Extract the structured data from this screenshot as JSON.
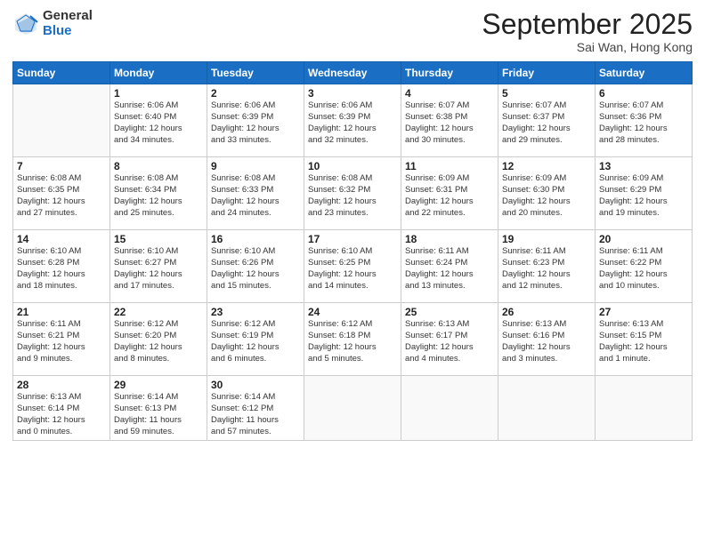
{
  "logo": {
    "general": "General",
    "blue": "Blue"
  },
  "title": "September 2025",
  "location": "Sai Wan, Hong Kong",
  "days_header": [
    "Sunday",
    "Monday",
    "Tuesday",
    "Wednesday",
    "Thursday",
    "Friday",
    "Saturday"
  ],
  "weeks": [
    [
      {
        "num": "",
        "info": ""
      },
      {
        "num": "1",
        "info": "Sunrise: 6:06 AM\nSunset: 6:40 PM\nDaylight: 12 hours\nand 34 minutes."
      },
      {
        "num": "2",
        "info": "Sunrise: 6:06 AM\nSunset: 6:39 PM\nDaylight: 12 hours\nand 33 minutes."
      },
      {
        "num": "3",
        "info": "Sunrise: 6:06 AM\nSunset: 6:39 PM\nDaylight: 12 hours\nand 32 minutes."
      },
      {
        "num": "4",
        "info": "Sunrise: 6:07 AM\nSunset: 6:38 PM\nDaylight: 12 hours\nand 30 minutes."
      },
      {
        "num": "5",
        "info": "Sunrise: 6:07 AM\nSunset: 6:37 PM\nDaylight: 12 hours\nand 29 minutes."
      },
      {
        "num": "6",
        "info": "Sunrise: 6:07 AM\nSunset: 6:36 PM\nDaylight: 12 hours\nand 28 minutes."
      }
    ],
    [
      {
        "num": "7",
        "info": "Sunrise: 6:08 AM\nSunset: 6:35 PM\nDaylight: 12 hours\nand 27 minutes."
      },
      {
        "num": "8",
        "info": "Sunrise: 6:08 AM\nSunset: 6:34 PM\nDaylight: 12 hours\nand 25 minutes."
      },
      {
        "num": "9",
        "info": "Sunrise: 6:08 AM\nSunset: 6:33 PM\nDaylight: 12 hours\nand 24 minutes."
      },
      {
        "num": "10",
        "info": "Sunrise: 6:08 AM\nSunset: 6:32 PM\nDaylight: 12 hours\nand 23 minutes."
      },
      {
        "num": "11",
        "info": "Sunrise: 6:09 AM\nSunset: 6:31 PM\nDaylight: 12 hours\nand 22 minutes."
      },
      {
        "num": "12",
        "info": "Sunrise: 6:09 AM\nSunset: 6:30 PM\nDaylight: 12 hours\nand 20 minutes."
      },
      {
        "num": "13",
        "info": "Sunrise: 6:09 AM\nSunset: 6:29 PM\nDaylight: 12 hours\nand 19 minutes."
      }
    ],
    [
      {
        "num": "14",
        "info": "Sunrise: 6:10 AM\nSunset: 6:28 PM\nDaylight: 12 hours\nand 18 minutes."
      },
      {
        "num": "15",
        "info": "Sunrise: 6:10 AM\nSunset: 6:27 PM\nDaylight: 12 hours\nand 17 minutes."
      },
      {
        "num": "16",
        "info": "Sunrise: 6:10 AM\nSunset: 6:26 PM\nDaylight: 12 hours\nand 15 minutes."
      },
      {
        "num": "17",
        "info": "Sunrise: 6:10 AM\nSunset: 6:25 PM\nDaylight: 12 hours\nand 14 minutes."
      },
      {
        "num": "18",
        "info": "Sunrise: 6:11 AM\nSunset: 6:24 PM\nDaylight: 12 hours\nand 13 minutes."
      },
      {
        "num": "19",
        "info": "Sunrise: 6:11 AM\nSunset: 6:23 PM\nDaylight: 12 hours\nand 12 minutes."
      },
      {
        "num": "20",
        "info": "Sunrise: 6:11 AM\nSunset: 6:22 PM\nDaylight: 12 hours\nand 10 minutes."
      }
    ],
    [
      {
        "num": "21",
        "info": "Sunrise: 6:11 AM\nSunset: 6:21 PM\nDaylight: 12 hours\nand 9 minutes."
      },
      {
        "num": "22",
        "info": "Sunrise: 6:12 AM\nSunset: 6:20 PM\nDaylight: 12 hours\nand 8 minutes."
      },
      {
        "num": "23",
        "info": "Sunrise: 6:12 AM\nSunset: 6:19 PM\nDaylight: 12 hours\nand 6 minutes."
      },
      {
        "num": "24",
        "info": "Sunrise: 6:12 AM\nSunset: 6:18 PM\nDaylight: 12 hours\nand 5 minutes."
      },
      {
        "num": "25",
        "info": "Sunrise: 6:13 AM\nSunset: 6:17 PM\nDaylight: 12 hours\nand 4 minutes."
      },
      {
        "num": "26",
        "info": "Sunrise: 6:13 AM\nSunset: 6:16 PM\nDaylight: 12 hours\nand 3 minutes."
      },
      {
        "num": "27",
        "info": "Sunrise: 6:13 AM\nSunset: 6:15 PM\nDaylight: 12 hours\nand 1 minute."
      }
    ],
    [
      {
        "num": "28",
        "info": "Sunrise: 6:13 AM\nSunset: 6:14 PM\nDaylight: 12 hours\nand 0 minutes."
      },
      {
        "num": "29",
        "info": "Sunrise: 6:14 AM\nSunset: 6:13 PM\nDaylight: 11 hours\nand 59 minutes."
      },
      {
        "num": "30",
        "info": "Sunrise: 6:14 AM\nSunset: 6:12 PM\nDaylight: 11 hours\nand 57 minutes."
      },
      {
        "num": "",
        "info": ""
      },
      {
        "num": "",
        "info": ""
      },
      {
        "num": "",
        "info": ""
      },
      {
        "num": "",
        "info": ""
      }
    ]
  ]
}
